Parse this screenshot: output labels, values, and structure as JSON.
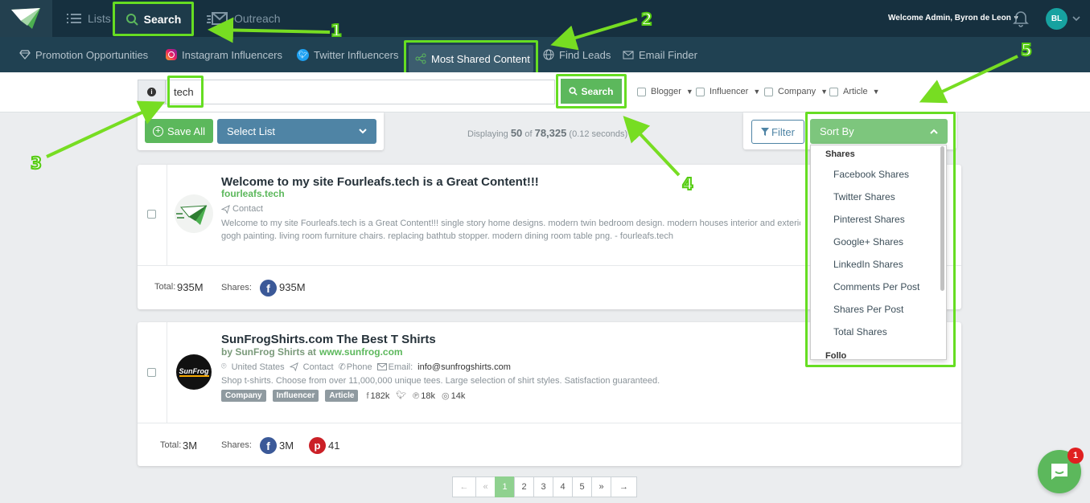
{
  "nav": {
    "lists": "Lists",
    "search": "Search",
    "outreach": "Outreach",
    "welcome": "Welcome Admin, Byron de Leon",
    "avatar": "BL"
  },
  "subnav": [
    "Promotion Opportunities",
    "Instagram Influencers",
    "Twitter Influencers",
    "Most Shared Content",
    "Find Leads",
    "Email Finder"
  ],
  "search": {
    "value": "tech",
    "button": "Search"
  },
  "filters": [
    "Blogger",
    "Influencer",
    "Company",
    "Article"
  ],
  "toolbar": {
    "save_all": "Save All",
    "select_list": "Select List",
    "filter": "Filter",
    "sort_by": "Sort By"
  },
  "display": {
    "prefix": "Displaying",
    "count": "50",
    "of": "of",
    "total": "78,325",
    "time": "(0.12 seconds)"
  },
  "sort_menu": {
    "group": "Shares",
    "options": [
      "Facebook Shares",
      "Twitter Shares",
      "Pinterest Shares",
      "Google+ Shares",
      "LinkedIn Shares",
      "Comments Per Post",
      "Shares Per Post",
      "Total Shares"
    ],
    "next_group": "Follo"
  },
  "results": [
    {
      "title": "Welcome to my site Fourleafs.tech is a Great Content!!!",
      "site": "fourleafs.tech",
      "contact": "Contact",
      "desc1": "Welcome to my site Fourleafs.tech is a Great Content!!! single story home designs. modern twin bedroom design. modern houses interior and exterior. the be",
      "desc2": "gogh painting. living room furniture chairs. replacing bathtub stopper. modern dining room table png. - fourleafs.tech",
      "total_label": "Total:",
      "total": "935M",
      "shares_label": "Shares:",
      "fb": "935M"
    },
    {
      "title": "SunFrogShirts.com The Best T Shirts",
      "by": "by SunFrog Shirts at",
      "site": "www.sunfrog.com",
      "location": "United States",
      "contact": "Contact",
      "phone": "Phone",
      "email_label": "Email:",
      "email": "info@sunfrogshirts.com",
      "desc": "Shop t-shirts. Choose from over 11,000,000 unique tees. Large selection of shirt styles. Satisfaction guaranteed.",
      "tags": [
        "Company",
        "Influencer",
        "Article"
      ],
      "facebook": "182k",
      "pinterest": "18k",
      "instagram": "14k",
      "total_label": "Total:",
      "total": "3M",
      "shares_label": "Shares:",
      "fb": "3M",
      "pin": "41",
      "logo_text": "SunFrog"
    }
  ],
  "pagination": [
    "←",
    "«",
    "1",
    "2",
    "3",
    "4",
    "5",
    "»",
    "→"
  ],
  "annotations": [
    "1",
    "2",
    "3",
    "4",
    "5"
  ],
  "chat_badge": "1"
}
